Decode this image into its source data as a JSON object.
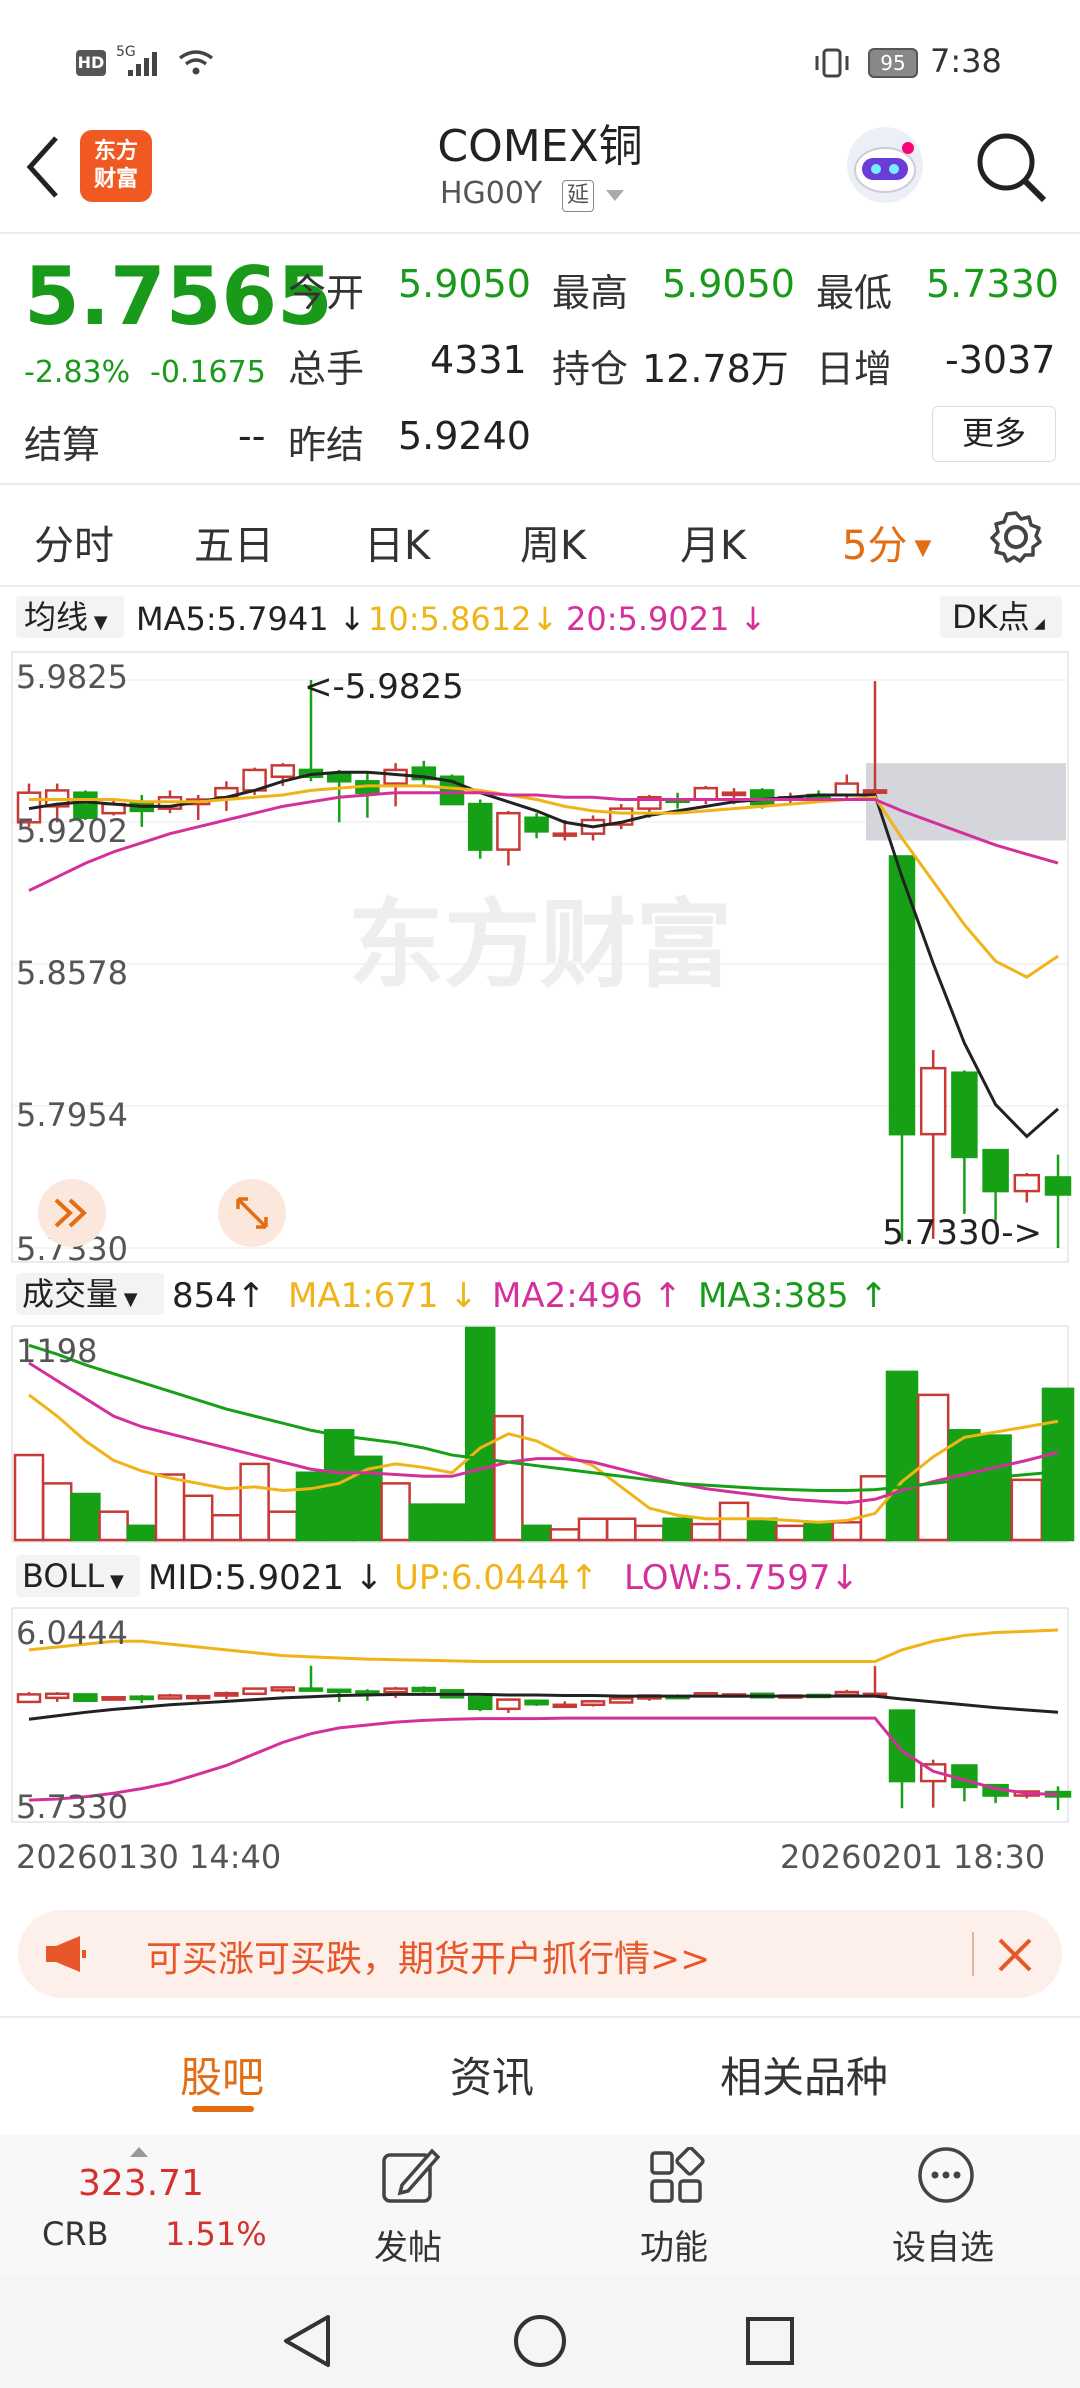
{
  "status_bar": {
    "time": "7:38",
    "battery": "95",
    "hd": "HD",
    "network": "5G"
  },
  "header": {
    "title": "COMEX铜",
    "code": "HG00Y",
    "delay_badge": "延",
    "logo_text_1": "东方",
    "logo_text_2": "财富"
  },
  "quote": {
    "price": "5.7565",
    "change_pct": "-2.83%",
    "change": "-0.1675",
    "open_label": "今开",
    "open": "5.9050",
    "high_label": "最高",
    "high": "5.9050",
    "low_label": "最低",
    "low": "5.7330",
    "volume_label": "总手",
    "volume": "4331",
    "oi_label": "持仓",
    "oi": "12.78万",
    "daily_inc_label": "日增",
    "daily_inc": "-3037",
    "settle_label": "结算",
    "settle": "--",
    "prev_settle_label": "昨结",
    "prev_settle": "5.9240",
    "more_label": "更多"
  },
  "tabs": [
    "分时",
    "五日",
    "日K",
    "周K",
    "月K"
  ],
  "active_tab": "5分",
  "ma_legend": {
    "type": "均线",
    "ma5": "MA5:5.7941",
    "ma10": "10:5.8612",
    "ma20": "20:5.9021",
    "dk": "DK点"
  },
  "vol_legend": {
    "type": "成交量",
    "val": "854",
    "ma1": "MA1:671",
    "ma2": "MA2:496",
    "ma3": "MA3:385"
  },
  "boll_legend": {
    "type": "BOLL",
    "mid": "MID:5.9021",
    "up": "UP:6.0444",
    "low": "LOW:5.7597"
  },
  "chart_data": [
    {
      "type": "candlestick",
      "title": "",
      "y_ticks": [
        "5.9825",
        "5.9202",
        "5.8578",
        "5.7954",
        "5.7330"
      ],
      "ylim": [
        5.733,
        5.9825
      ],
      "annotations": [
        "<-5.9825",
        "5.7330->"
      ],
      "watermark": "东方财富",
      "candles": [
        {
          "o": 5.92,
          "h": 5.937,
          "l": 5.918,
          "c": 5.933
        },
        {
          "o": 5.927,
          "h": 5.937,
          "l": 5.92,
          "c": 5.934
        },
        {
          "o": 5.933,
          "h": 5.934,
          "l": 5.921,
          "c": 5.922
        },
        {
          "o": 5.924,
          "h": 5.93,
          "l": 5.923,
          "c": 5.928
        },
        {
          "o": 5.929,
          "h": 5.932,
          "l": 5.918,
          "c": 5.925
        },
        {
          "o": 5.926,
          "h": 5.934,
          "l": 5.924,
          "c": 5.931
        },
        {
          "o": 5.928,
          "h": 5.932,
          "l": 5.921,
          "c": 5.93
        },
        {
          "o": 5.931,
          "h": 5.938,
          "l": 5.925,
          "c": 5.935
        },
        {
          "o": 5.934,
          "h": 5.944,
          "l": 5.932,
          "c": 5.943
        },
        {
          "o": 5.94,
          "h": 5.946,
          "l": 5.936,
          "c": 5.945
        },
        {
          "o": 5.943,
          "h": 5.9825,
          "l": 5.938,
          "c": 5.94
        },
        {
          "o": 5.941,
          "h": 5.943,
          "l": 5.92,
          "c": 5.938
        },
        {
          "o": 5.938,
          "h": 5.942,
          "l": 5.922,
          "c": 5.933
        },
        {
          "o": 5.937,
          "h": 5.946,
          "l": 5.927,
          "c": 5.943
        },
        {
          "o": 5.944,
          "h": 5.947,
          "l": 5.936,
          "c": 5.939
        },
        {
          "o": 5.94,
          "h": 5.941,
          "l": 5.928,
          "c": 5.928
        },
        {
          "o": 5.928,
          "h": 5.93,
          "l": 5.904,
          "c": 5.908
        },
        {
          "o": 5.908,
          "h": 5.925,
          "l": 5.901,
          "c": 5.924
        },
        {
          "o": 5.922,
          "h": 5.924,
          "l": 5.913,
          "c": 5.916
        },
        {
          "o": 5.915,
          "h": 5.921,
          "l": 5.912,
          "c": 5.915
        },
        {
          "o": 5.915,
          "h": 5.923,
          "l": 5.912,
          "c": 5.921
        },
        {
          "o": 5.919,
          "h": 5.928,
          "l": 5.917,
          "c": 5.926
        },
        {
          "o": 5.926,
          "h": 5.932,
          "l": 5.922,
          "c": 5.931
        },
        {
          "o": 5.93,
          "h": 5.933,
          "l": 5.926,
          "c": 5.929
        },
        {
          "o": 5.93,
          "h": 5.936,
          "l": 5.928,
          "c": 5.935
        },
        {
          "o": 5.932,
          "h": 5.935,
          "l": 5.928,
          "c": 5.933
        },
        {
          "o": 5.934,
          "h": 5.935,
          "l": 5.926,
          "c": 5.928
        },
        {
          "o": 5.93,
          "h": 5.933,
          "l": 5.928,
          "c": 5.931
        },
        {
          "o": 5.932,
          "h": 5.934,
          "l": 5.929,
          "c": 5.931
        },
        {
          "o": 5.932,
          "h": 5.941,
          "l": 5.93,
          "c": 5.937
        },
        {
          "o": 5.933,
          "h": 5.982,
          "l": 5.93,
          "c": 5.934
        },
        {
          "o": 5.905,
          "h": 5.905,
          "l": 5.736,
          "c": 5.783
        },
        {
          "o": 5.783,
          "h": 5.82,
          "l": 5.737,
          "c": 5.812
        },
        {
          "o": 5.81,
          "h": 5.811,
          "l": 5.748,
          "c": 5.773
        },
        {
          "o": 5.776,
          "h": 5.776,
          "l": 5.745,
          "c": 5.758
        },
        {
          "o": 5.758,
          "h": 5.766,
          "l": 5.753,
          "c": 5.765
        },
        {
          "o": 5.764,
          "h": 5.774,
          "l": 5.733,
          "c": 5.7565
        }
      ],
      "ma5": [
        5.926,
        5.928,
        5.929,
        5.928,
        5.927,
        5.927,
        5.929,
        5.931,
        5.934,
        5.938,
        5.941,
        5.942,
        5.942,
        5.941,
        5.94,
        5.938,
        5.933,
        5.929,
        5.925,
        5.92,
        5.918,
        5.92,
        5.923,
        5.925,
        5.927,
        5.929,
        5.93,
        5.931,
        5.932,
        5.932,
        5.932,
        5.896,
        5.858,
        5.823,
        5.796,
        5.782,
        5.7941
      ],
      "ma10": [
        5.93,
        5.93,
        5.93,
        5.93,
        5.929,
        5.929,
        5.929,
        5.93,
        5.931,
        5.932,
        5.934,
        5.935,
        5.936,
        5.936,
        5.936,
        5.935,
        5.934,
        5.932,
        5.93,
        5.927,
        5.925,
        5.924,
        5.924,
        5.924,
        5.925,
        5.926,
        5.927,
        5.928,
        5.929,
        5.93,
        5.931,
        5.913,
        5.894,
        5.875,
        5.859,
        5.852,
        5.8612
      ],
      "ma20": [
        5.89,
        5.896,
        5.902,
        5.907,
        5.911,
        5.915,
        5.918,
        5.921,
        5.924,
        5.927,
        5.929,
        5.931,
        5.932,
        5.933,
        5.933,
        5.933,
        5.933,
        5.932,
        5.932,
        5.931,
        5.931,
        5.93,
        5.93,
        5.93,
        5.93,
        5.93,
        5.93,
        5.93,
        5.93,
        5.93,
        5.93,
        5.925,
        5.92,
        5.915,
        5.91,
        5.906,
        5.9021
      ]
    },
    {
      "type": "bar",
      "title": "成交量",
      "y_ticks": [
        "1198"
      ],
      "volumes": [
        480,
        320,
        260,
        160,
        80,
        370,
        250,
        140,
        430,
        160,
        380,
        620,
        470,
        320,
        200,
        200,
        1198,
        700,
        80,
        60,
        120,
        120,
        80,
        120,
        90,
        210,
        120,
        80,
        90,
        100,
        360,
        950,
        820,
        620,
        590,
        340,
        854
      ],
      "ma1": [
        820,
        700,
        560,
        450,
        390,
        350,
        320,
        290,
        300,
        280,
        290,
        320,
        400,
        430,
        410,
        380,
        520,
        600,
        560,
        480,
        420,
        300,
        180,
        140,
        120,
        120,
        120,
        110,
        100,
        110,
        150,
        330,
        470,
        580,
        610,
        640,
        671
      ],
      "ma2": [
        1000,
        900,
        800,
        700,
        640,
        600,
        560,
        520,
        480,
        440,
        400,
        380,
        380,
        370,
        360,
        360,
        400,
        440,
        460,
        460,
        440,
        400,
        360,
        320,
        290,
        270,
        250,
        230,
        220,
        210,
        230,
        280,
        330,
        370,
        410,
        450,
        496
      ],
      "ma3": [
        1100,
        1050,
        990,
        940,
        890,
        840,
        790,
        740,
        700,
        660,
        620,
        590,
        570,
        550,
        520,
        480,
        460,
        440,
        420,
        400,
        380,
        360,
        340,
        320,
        310,
        300,
        290,
        285,
        280,
        280,
        285,
        300,
        320,
        340,
        355,
        370,
        385
      ]
    },
    {
      "type": "line",
      "title": "BOLL",
      "y_ticks": [
        "6.0444",
        "5.7330"
      ],
      "ylim": [
        5.733,
        6.0444
      ],
      "up": [
        6.01,
        6.015,
        6.02,
        6.025,
        6.025,
        6.02,
        6.015,
        6.01,
        6.005,
        6.0,
        5.998,
        5.996,
        5.994,
        5.993,
        5.992,
        5.991,
        5.99,
        5.99,
        5.99,
        5.99,
        5.99,
        5.99,
        5.99,
        5.99,
        5.99,
        5.99,
        5.99,
        5.99,
        5.99,
        5.99,
        5.99,
        6.01,
        6.025,
        6.035,
        6.04,
        6.042,
        6.0444
      ],
      "mid": [
        5.89,
        5.896,
        5.902,
        5.907,
        5.911,
        5.915,
        5.918,
        5.921,
        5.924,
        5.927,
        5.929,
        5.931,
        5.932,
        5.933,
        5.933,
        5.933,
        5.933,
        5.932,
        5.932,
        5.931,
        5.931,
        5.93,
        5.93,
        5.93,
        5.93,
        5.93,
        5.93,
        5.93,
        5.93,
        5.93,
        5.93,
        5.925,
        5.92,
        5.915,
        5.91,
        5.906,
        5.9021
      ],
      "low": [
        5.75,
        5.752,
        5.756,
        5.762,
        5.77,
        5.78,
        5.795,
        5.81,
        5.83,
        5.85,
        5.865,
        5.875,
        5.88,
        5.885,
        5.888,
        5.89,
        5.891,
        5.891,
        5.891,
        5.892,
        5.892,
        5.892,
        5.892,
        5.892,
        5.892,
        5.892,
        5.892,
        5.892,
        5.892,
        5.892,
        5.892,
        5.835,
        5.8,
        5.785,
        5.77,
        5.762,
        5.7597
      ]
    }
  ],
  "time_axis": {
    "start": "20260130 14:40",
    "end": "20260201 18:30"
  },
  "banner": {
    "text": "可买涨可买跌，期货开户抓行情>>"
  },
  "sub_tabs": [
    "股吧",
    "资讯",
    "相关品种"
  ],
  "bottom_bar": {
    "index_value": "323.71",
    "index_name": "CRB",
    "index_change": "1.51%",
    "post_label": "发帖",
    "func_label": "功能",
    "watch_label": "设自选"
  }
}
